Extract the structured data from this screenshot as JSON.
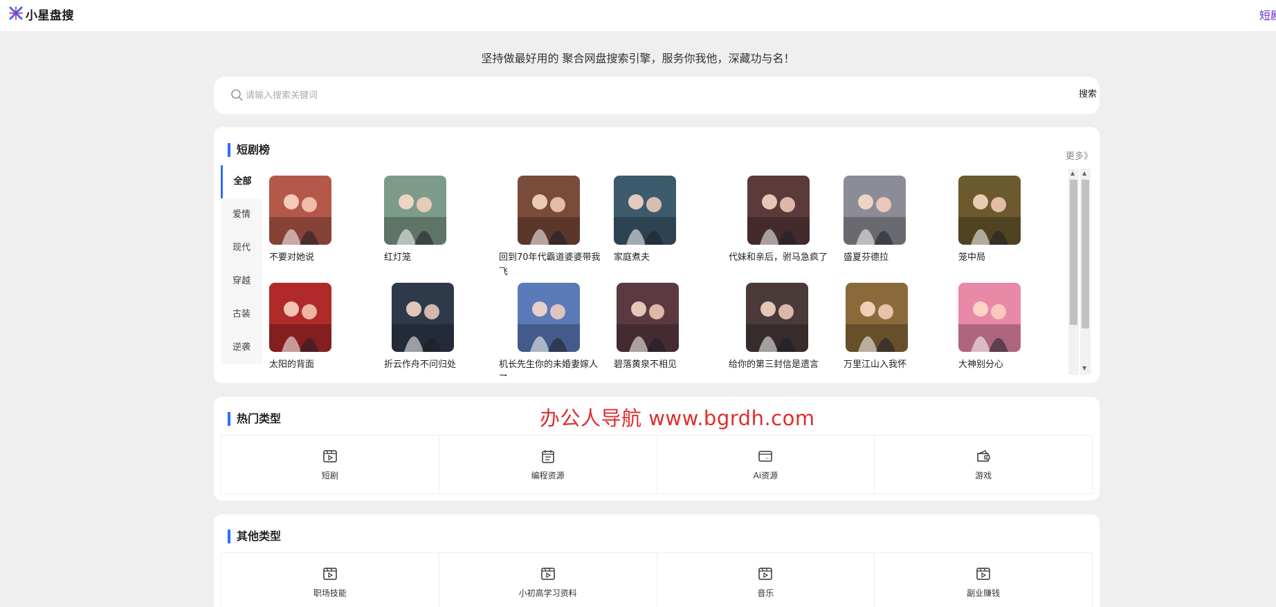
{
  "header": {
    "brand": "小星盘搜",
    "top_right_link": "短剧",
    "logo_icon": "star-logo-icon"
  },
  "tagline": "坚持做最好用的 聚合网盘搜索引擎，服务你我他，深藏功与名！",
  "search": {
    "placeholder": "请输入搜索关键词",
    "value": "",
    "button_label": "搜索"
  },
  "ranking": {
    "title": "短剧榜",
    "more_label": "更多》",
    "categories": [
      "全部",
      "爱情",
      "现代",
      "穿越",
      "古装",
      "逆袭"
    ],
    "active_category": "全部",
    "items": [
      {
        "title": "不要对她说",
        "color": "#b4584a"
      },
      {
        "title": "红灯笼",
        "color": "#7d9b8a"
      },
      {
        "title": "回到70年代霸道婆婆带我飞",
        "color": "#7a4a3a"
      },
      {
        "title": "家庭煮夫",
        "color": "#3c5a6c"
      },
      {
        "title": "代妹和亲后，驸马急疯了",
        "color": "#5a3a3a"
      },
      {
        "title": "盛夏芬德拉",
        "color": "#8c8c96"
      },
      {
        "title": "笼中局",
        "color": "#6b5a2e"
      },
      {
        "title": "太阳的背面",
        "color": "#b02a2a"
      },
      {
        "title": "折云作舟不问归处",
        "color": "#2e3a4a"
      },
      {
        "title": "机长先生你的未婚妻嫁人了",
        "color": "#5a7ab8"
      },
      {
        "title": "碧落黄泉不相见",
        "color": "#5a3a40"
      },
      {
        "title": "给你的第三封信是遗言",
        "color": "#4a3a3a"
      },
      {
        "title": "万里江山入我怀",
        "color": "#8a6a3a"
      },
      {
        "title": "大神别分心",
        "color": "#e889a8"
      }
    ]
  },
  "hot_types": {
    "title": "热门类型",
    "items": [
      {
        "label": "短剧",
        "icon": "video-icon"
      },
      {
        "label": "编程资源",
        "icon": "calendar-icon"
      },
      {
        "label": "Ai资源",
        "icon": "browser-icon"
      },
      {
        "label": "游戏",
        "icon": "wallet-icon"
      }
    ]
  },
  "other_types": {
    "title": "其他类型",
    "items": [
      {
        "label": "职场技能",
        "icon": "video-icon"
      },
      {
        "label": "小初高学习资料",
        "icon": "video-icon"
      },
      {
        "label": "音乐",
        "icon": "video-icon"
      },
      {
        "label": "副业赚钱",
        "icon": "video-icon"
      }
    ]
  },
  "watermark": "办公人导航  www.bgrdh.com",
  "colors": {
    "accent": "#2d6cff",
    "watermark": "#e12c2c",
    "background": "#f0eff0"
  }
}
